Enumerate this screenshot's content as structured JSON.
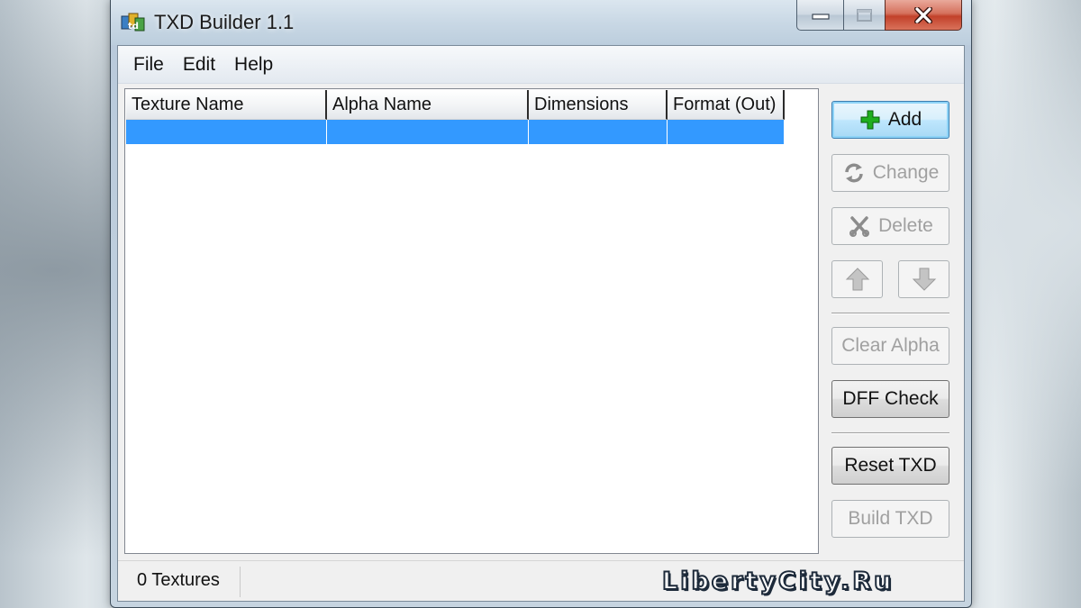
{
  "window": {
    "title": "TXD Builder 1.1",
    "caption": {
      "minimize": "minimize",
      "maximize": "maximize",
      "close": "close"
    }
  },
  "menu": [
    "File",
    "Edit",
    "Help"
  ],
  "list": {
    "columns": [
      "Texture Name",
      "Alpha Name",
      "Dimensions",
      "Format (Out)"
    ],
    "rows": [
      [
        "",
        "",
        "",
        ""
      ]
    ]
  },
  "buttons": {
    "add": "Add",
    "change": "Change",
    "delete": "Delete",
    "move_up": "move up",
    "move_down": "move down",
    "clear_alpha": "Clear Alpha",
    "dff_check": "DFF Check",
    "reset_txd": "Reset TXD",
    "build_txd": "Build TXD"
  },
  "status": {
    "texture_count": "0 Textures"
  },
  "watermark": "LibertyCity.Ru",
  "colors": {
    "selection": "#3399ff",
    "add_icon": "#1fae1f",
    "close_button": "#c2412a"
  },
  "icons": {
    "app": "txd-builder-app-icon",
    "add": "plus-icon",
    "change": "refresh-icon",
    "delete": "scissors-x-icon",
    "up": "arrow-up-icon",
    "down": "arrow-down-icon"
  }
}
